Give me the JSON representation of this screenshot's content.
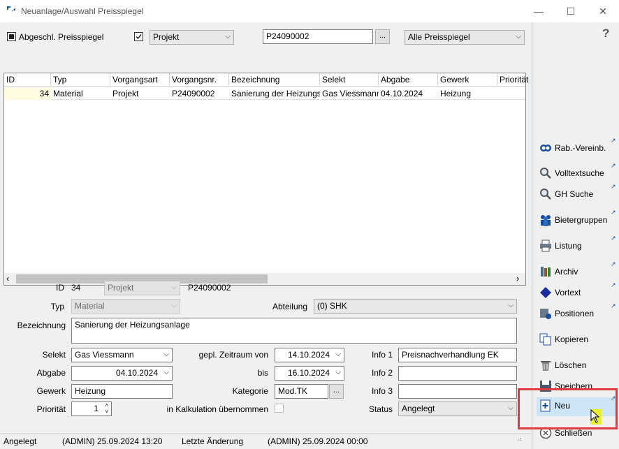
{
  "window": {
    "title": "Neuanlage/Auswahl Preisspiegel",
    "minimize": "—",
    "maximize": "☐",
    "close": "✕"
  },
  "filters": {
    "abgeschl_label": "Abgeschl. Preisspiegel",
    "projekt_checked": true,
    "projekt_select": "Projekt",
    "vorgang_value": "P24090002",
    "dots": "...",
    "preisspiegel_select": "Alle Preisspiegel"
  },
  "grid": {
    "columns": [
      "ID",
      "Typ",
      "Vorgangsart",
      "Vorgangsnr.",
      "Bezeichnung",
      "Selekt",
      "Abgabe",
      "Gewerk",
      "Priorität"
    ],
    "rows": [
      [
        "34",
        "Material",
        "Projekt",
        "P24090002",
        "Sanierung der Heizungsanlage",
        "Gas Viessmann",
        "04.10.2024",
        "Heizung",
        ""
      ]
    ],
    "scroll_left": "‹",
    "scroll_right": "›"
  },
  "form": {
    "id_label": "ID",
    "id_value": "34",
    "vorgangsart_value": "Projekt",
    "vorgangsnr_value": "P24090002",
    "typ_label": "Typ",
    "typ_value": "Material",
    "abteilung_label": "Abteilung",
    "abteilung_value": "(0) SHK",
    "bezeichnung_label": "Bezeichnung",
    "bezeichnung_value": "Sanierung der Heizungsanlage",
    "selekt_label": "Selekt",
    "selekt_value": "Gas Viessmann",
    "zeitraum_label": "gepl. Zeitraum von",
    "zeitraum_von": "14.10.2024",
    "info1_label": "Info 1",
    "info1_value": "Preisnachverhandlung EK",
    "abgabe_label": "Abgabe",
    "abgabe_value": "04.10.2024",
    "bis_label": "bis",
    "bis_value": "16.10.2024",
    "info2_label": "Info 2",
    "info2_value": "",
    "gewerk_label": "Gewerk",
    "gewerk_value": "Heizung",
    "kategorie_label": "Kategorie",
    "kategorie_value": "Mod.TK",
    "info3_label": "Info 3",
    "info3_value": "",
    "prioritaet_label": "Priorität",
    "prioritaet_value": "1",
    "kalkulation_label": "in Kalkulation übernommen",
    "status_label": "Status",
    "status_value": "Angelegt"
  },
  "sidebar": {
    "help": "?",
    "items": [
      {
        "label": "Rab.-Vereinb.",
        "icon": "currency-exchange-icon"
      },
      {
        "label": "Volltextsuche",
        "icon": "search-icon"
      },
      {
        "label": "GH Suche",
        "icon": "search-icon"
      },
      {
        "label": "Bietergruppen",
        "icon": "group-icon"
      },
      {
        "label": "Listung",
        "icon": "printer-icon"
      },
      {
        "label": "Archiv",
        "icon": "archive-icon"
      },
      {
        "label": "Vortext",
        "icon": "diamond-icon"
      },
      {
        "label": "Positionen",
        "icon": "positions-icon"
      },
      {
        "label": "Kopieren",
        "icon": "copy-icon"
      },
      {
        "label": "Löschen",
        "icon": "trash-icon"
      },
      {
        "label": "Speichern",
        "icon": "save-icon"
      },
      {
        "label": "Neu",
        "icon": "new-document-icon"
      },
      {
        "label": "Schließen",
        "icon": "close-circle-icon"
      }
    ]
  },
  "status": {
    "state": "Angelegt",
    "created": "(ADMIN) 25.09.2024 13:20",
    "changed_label": "Letzte Änderung",
    "changed": "(ADMIN) 25.09.2024 00:00"
  },
  "colors": {
    "highlight_red": "#e0393e",
    "selected_row": "#fffff0",
    "link_blue": "#1a4c9c"
  }
}
